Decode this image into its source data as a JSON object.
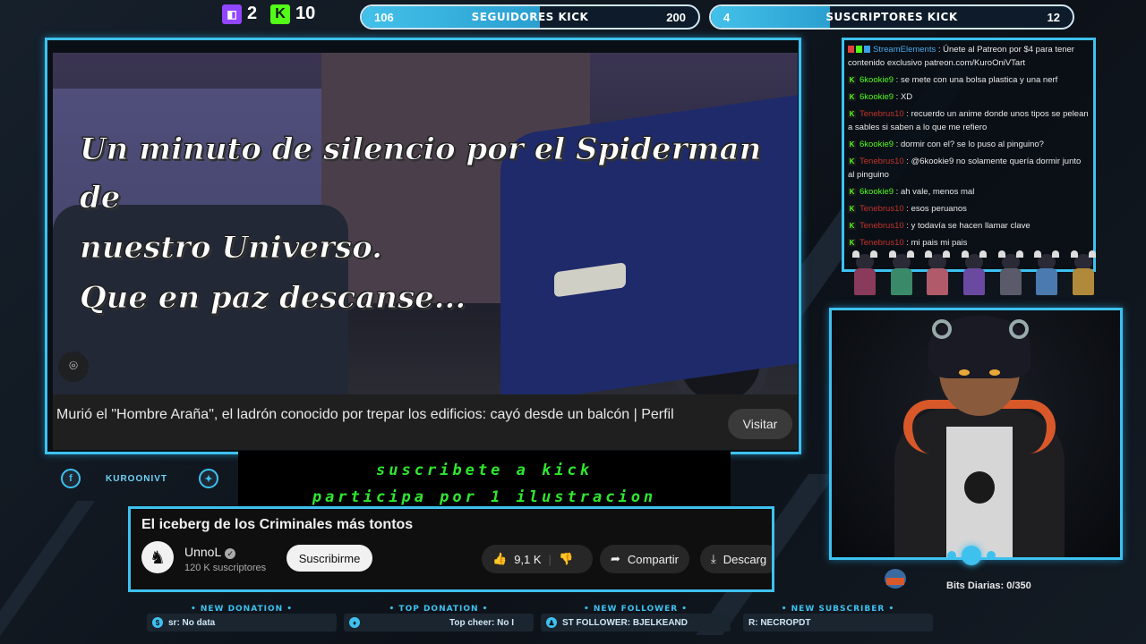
{
  "top": {
    "twitch_count": "2",
    "kick_count": "10",
    "followers_goal": {
      "current": "106",
      "title": "SEGUIDORES KICK",
      "target": "200",
      "progress": 0.53
    },
    "subscribers_goal": {
      "current": "4",
      "title": "SUSCRIPTORES KICK",
      "target": "12",
      "progress": 0.33
    }
  },
  "video": {
    "overlay_lines": [
      "Un minuto de silencio por el Spiderman",
      "de",
      "nuestro Universo.",
      "Que en paz descanse..."
    ],
    "caption": "Murió el \"Hombre Araña\", el ladrón conocido por trepar los edificios: cayó desde un balcón | Perfil",
    "visit_label": "Visitar"
  },
  "social": {
    "handle": "KUROONIVT"
  },
  "banner": {
    "line1": "suscribete a kick",
    "line2": "participa por 1 ilustracion"
  },
  "youtube": {
    "title": "El iceberg de los Criminales más tontos",
    "channel": "UnnoL",
    "subscribers": "120 K suscriptores",
    "subscribe_label": "Suscribirme",
    "likes": "9,1 K",
    "share_label": "Compartir",
    "download_label": "Descarg"
  },
  "alerts": [
    {
      "title": "• NEW DONATION •",
      "value": "sr: No data"
    },
    {
      "title": "• TOP DONATION •",
      "value": "Top cheer: No I"
    },
    {
      "title": "• NEW FOLLOWER •",
      "value": "ST FOLLOWER: BJELKEAND"
    },
    {
      "title": "• NEW SUBSCRIBER •",
      "value": "R: NECROPDT"
    }
  ],
  "chat": [
    {
      "user": "StreamElements",
      "text": "Únete al Patreon por $4 para tener contenido exclusivo patreon.com/KuroOniVTart"
    },
    {
      "user": "6kookie9",
      "text": "se mete con una bolsa plastica y una nerf"
    },
    {
      "user": "6kookie9",
      "text": "XD"
    },
    {
      "user": "Tenebrus10",
      "text": "recuerdo un anime donde unos tipos se pelean a sables si saben a lo que me refiero"
    },
    {
      "user": "6kookie9",
      "text": "dormir con el? se lo puso al pinguino?"
    },
    {
      "user": "Tenebrus10",
      "text": "@6kookie9 no solamente quería dormir junto al pinguino"
    },
    {
      "user": "6kookie9",
      "text": "ah vale, menos mal"
    },
    {
      "user": "Tenebrus10",
      "text": "esos peruanos"
    },
    {
      "user": "Tenebrus10",
      "text": "y todavía se hacen llamar clave"
    },
    {
      "user": "Tenebrus10",
      "text": "mi pais mi pais"
    }
  ],
  "bits": {
    "label": "Bits Diarias:",
    "value": "0/350"
  },
  "colors": {
    "accent": "#3ec1ef",
    "kick_green": "#53fc18",
    "twitch_purple": "#9146ff"
  }
}
